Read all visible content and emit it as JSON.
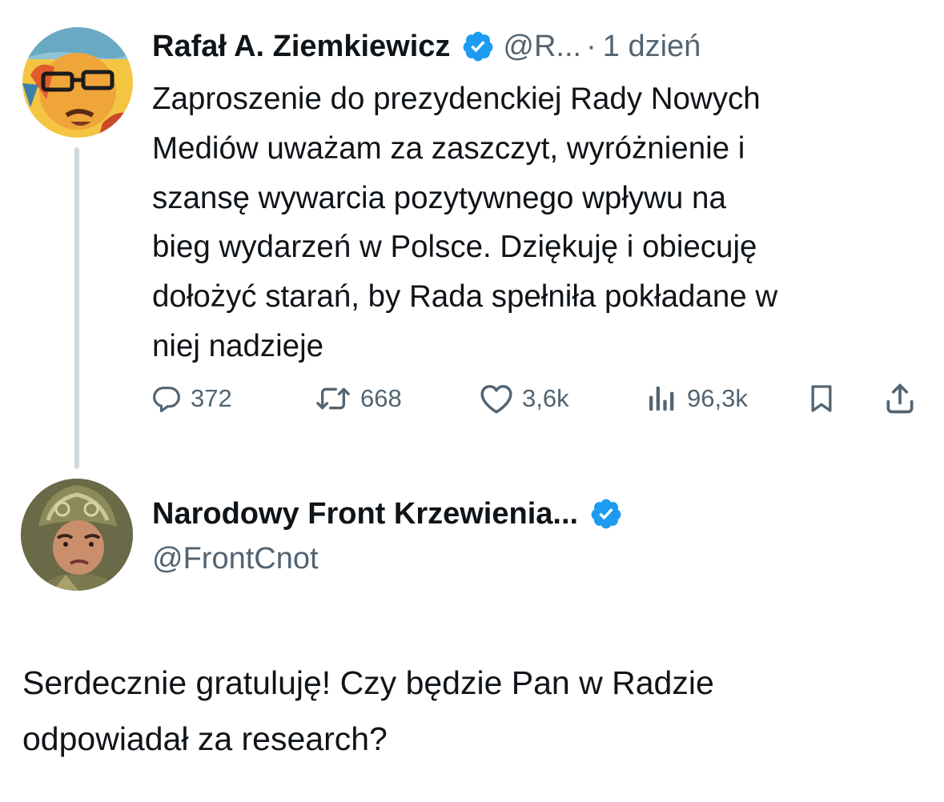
{
  "tweet": {
    "author_name": "Rafał A. Ziemkiewicz",
    "author_handle": "@R...",
    "separator": "·",
    "time": "1 dzień",
    "text_lines": [
      "Zaproszenie do prezydenckiej Rady Nowych",
      "Mediów uważam za zaszczyt, wyróżnienie i",
      "szansę wywarcia pozytywnego wpływu na",
      "bieg wydarzeń w Polsce. Dziękuję i obiecuję",
      "dołożyć starań, by Rada spełniła pokładane w",
      "niej nadzieje"
    ],
    "stats": {
      "replies": "372",
      "reposts": "668",
      "likes": "3,6k",
      "views": "96,3k"
    },
    "icons": {
      "verified": "verified-badge-icon",
      "reply": "reply-icon",
      "repost": "repost-icon",
      "like": "heart-icon",
      "views": "views-chart-icon",
      "bookmark": "bookmark-icon",
      "share": "share-icon"
    }
  },
  "reply": {
    "author_name": "Narodowy Front Krzewienia...",
    "author_handle": "@FrontCnot",
    "text_lines": [
      "Serdecznie gratuluję! Czy będzie Pan w Radzie",
      "odpowiadał za research?"
    ]
  },
  "colors": {
    "text": "#0f1419",
    "secondary": "#536471",
    "verified": "#1d9bf0",
    "thread_line": "#cfd9de"
  }
}
